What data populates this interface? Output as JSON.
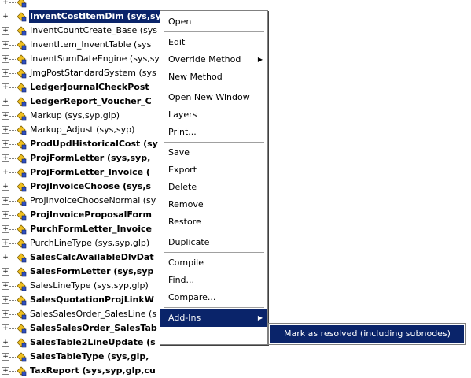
{
  "tree": {
    "rows": [
      {
        "label": "",
        "bold": false,
        "selected": false
      },
      {
        "label": "InventCostItemDim (sys,syp,cus)",
        "bold": true,
        "selected": true
      },
      {
        "label": "InventCountCreate_Base (sys",
        "bold": false,
        "selected": false
      },
      {
        "label": "InventItem_InventTable (sys",
        "bold": false,
        "selected": false
      },
      {
        "label": "InventSumDateEngine (sys,sy",
        "bold": false,
        "selected": false
      },
      {
        "label": "JmgPostStandardSystem (sys",
        "bold": false,
        "selected": false
      },
      {
        "label": "LedgerJournalCheckPost",
        "bold": true,
        "selected": false
      },
      {
        "label": "LedgerReport_Voucher_C",
        "bold": true,
        "selected": false
      },
      {
        "label": "Markup (sys,syp,glp)",
        "bold": false,
        "selected": false
      },
      {
        "label": "Markup_Adjust (sys,syp)",
        "bold": false,
        "selected": false
      },
      {
        "label": "ProdUpdHistoricalCost (sy",
        "bold": true,
        "selected": false
      },
      {
        "label": "ProjFormLetter (sys,syp,",
        "bold": true,
        "selected": false
      },
      {
        "label": "ProjFormLetter_Invoice (",
        "bold": true,
        "selected": false
      },
      {
        "label": "ProjInvoiceChoose (sys,s",
        "bold": true,
        "selected": false
      },
      {
        "label": "ProjInvoiceChooseNormal (sy",
        "bold": false,
        "selected": false
      },
      {
        "label": "ProjInvoiceProposalForm",
        "bold": true,
        "selected": false
      },
      {
        "label": "PurchFormLetter_Invoice",
        "bold": true,
        "selected": false
      },
      {
        "label": "PurchLineType (sys,syp,glp)",
        "bold": false,
        "selected": false
      },
      {
        "label": "SalesCalcAvailableDlvDat",
        "bold": true,
        "selected": false
      },
      {
        "label": "SalesFormLetter (sys,syp",
        "bold": true,
        "selected": false
      },
      {
        "label": "SalesLineType (sys,syp,glp)",
        "bold": false,
        "selected": false
      },
      {
        "label": "SalesQuotationProjLinkW",
        "bold": true,
        "selected": false
      },
      {
        "label": "SalesSalesOrder_SalesLine (s",
        "bold": false,
        "selected": false
      },
      {
        "label": "SalesSalesOrder_SalesTab",
        "bold": true,
        "selected": false
      },
      {
        "label": "SalesTable2LineUpdate (s",
        "bold": true,
        "selected": false
      },
      {
        "label": "SalesTableType (sys,glp,",
        "bold": true,
        "selected": false
      },
      {
        "label": "TaxReport (sys,syp,glp,cu",
        "bold": true,
        "selected": false
      }
    ]
  },
  "menu": {
    "items": [
      {
        "label": "Open",
        "submenu": false,
        "sep_after": true
      },
      {
        "label": "Edit",
        "submenu": false,
        "sep_after": false
      },
      {
        "label": "Override Method",
        "submenu": true,
        "sep_after": false
      },
      {
        "label": "New Method",
        "submenu": false,
        "sep_after": true
      },
      {
        "label": "Open New Window",
        "submenu": false,
        "sep_after": false
      },
      {
        "label": "Layers",
        "submenu": false,
        "sep_after": false
      },
      {
        "label": "Print...",
        "submenu": false,
        "sep_after": true
      },
      {
        "label": "Save",
        "submenu": false,
        "sep_after": false
      },
      {
        "label": "Export",
        "submenu": false,
        "sep_after": false
      },
      {
        "label": "Delete",
        "submenu": false,
        "sep_after": false
      },
      {
        "label": "Remove",
        "submenu": false,
        "sep_after": false
      },
      {
        "label": "Restore",
        "submenu": false,
        "sep_after": true
      },
      {
        "label": "Duplicate",
        "submenu": false,
        "sep_after": true
      },
      {
        "label": "Compile",
        "submenu": false,
        "sep_after": false
      },
      {
        "label": "Find...",
        "submenu": false,
        "sep_after": false
      },
      {
        "label": "Compare...",
        "submenu": false,
        "sep_after": true
      },
      {
        "label": "Add-Ins",
        "submenu": true,
        "sep_after": false,
        "highlighted": true
      }
    ]
  },
  "submenu": {
    "item": "Mark as resolved (including subnodes)"
  },
  "colors": {
    "highlight": "#0a246a",
    "icon_yellow": "#f0c020",
    "icon_blue": "#3050c0"
  },
  "icons": {
    "expander": "plus-box",
    "node": "class-icon"
  }
}
